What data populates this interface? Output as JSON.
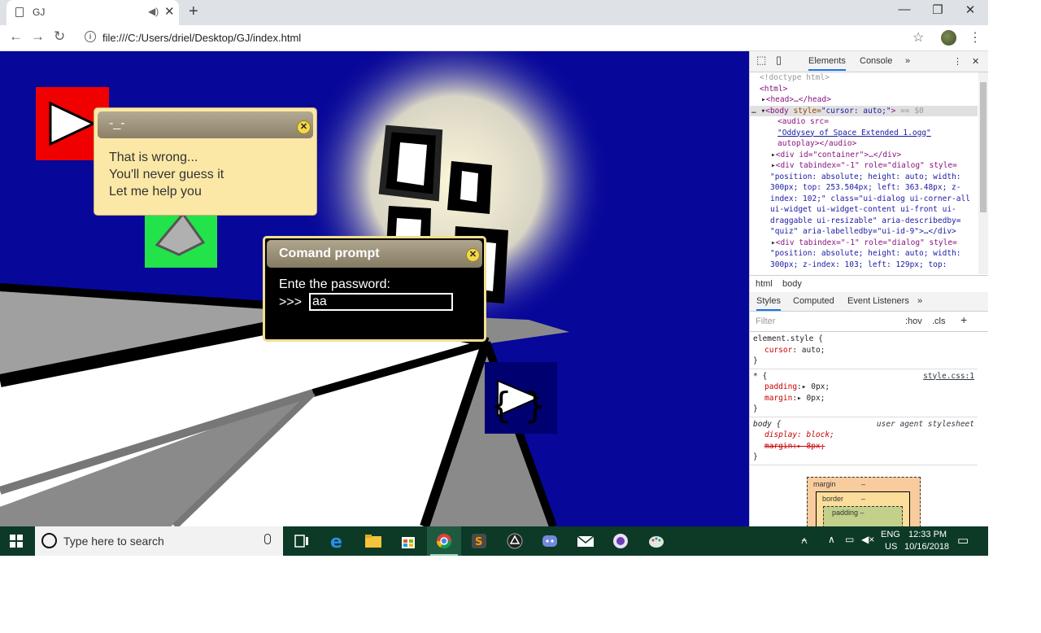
{
  "browser": {
    "tab_title": "GJ",
    "tab_audio_icon": "speaker-icon",
    "url": "file:///C:/Users/driel/Desktop/GJ/index.html",
    "icons": {
      "back": "arrow-left-icon",
      "forward": "arrow-right-icon",
      "reload": "reload-icon",
      "bookmark": "star-icon",
      "menu": "kebab-icon"
    }
  },
  "game": {
    "wrong_dialog": {
      "title": "-_-",
      "lines": [
        "That is wrong...",
        "You'll never guess it",
        "Let me help you"
      ]
    },
    "prompt_dialog": {
      "title": "Comand prompt",
      "instruction": "Ente the password:",
      "cursor": ">>>",
      "input_value": "aa"
    }
  },
  "devtools": {
    "tabs": [
      "Elements",
      "Console"
    ],
    "active_tab": "Elements",
    "dom_lines": {
      "doctype": "<!doctype html>",
      "html": "<html>",
      "head": "<head>…</head>",
      "body_tag": "<body",
      "body_attr": " style=",
      "body_val": "\"cursor: auto;\"",
      "body_end": ">",
      "body_eq": " == $0",
      "audio_tag": "<audio src=",
      "audio_link": "\"Oddysey of Space Extended 1.ogg\"",
      "audio_autoplay": "autoplay></audio>",
      "container_div": "<div id=\"container\">…</div>",
      "div1_l1": "<div tabindex=\"-1\" role=\"dialog\" style=",
      "div1_l2": "\"position: absolute; height: auto; width:",
      "div1_l3": "300px; top: 253.504px; left: 363.48px; z-",
      "div1_l4": "index: 102;\" class=\"ui-dialog ui-corner-all",
      "div1_l5": "ui-widget ui-widget-content ui-front ui-",
      "div1_l6": "draggable ui-resizable\" aria-describedby=",
      "div1_l7": "\"quiz\" aria-labelledby=\"ui-id-9\">…</div>",
      "div2_l1": "<div tabindex=\"-1\" role=\"dialog\" style=",
      "div2_l2": "\"position: absolute; height: auto; width:",
      "div2_l3": "300px; z-index: 103; left: 129px; top:"
    },
    "breadcrumbs": [
      "html",
      "body"
    ],
    "styles_tabs": [
      "Styles",
      "Computed",
      "Event Listeners"
    ],
    "filter_placeholder": "Filter",
    "filter_hov": ":hov",
    "filter_cls": ".cls",
    "rules": {
      "element_selector": "element.style {",
      "element_prop": "cursor",
      "element_val": "auto;",
      "star_selector": "* {",
      "star_source": "style.css:1",
      "star_padding": "padding",
      "star_padding_val": "0px;",
      "star_margin": "margin",
      "star_margin_val": "0px;",
      "body_selector": "body {",
      "body_source": "user agent stylesheet",
      "body_display": "display: block;",
      "body_margin": "margin:▸ 8px;",
      "close_brace": "}"
    },
    "box_model": {
      "margin": "margin",
      "margin_val": "–",
      "border": "border",
      "border_val": "–",
      "padding": "padding –"
    }
  },
  "taskbar": {
    "search_placeholder": "Type here to search",
    "lang_1": "ENG",
    "lang_2": "US",
    "time": "12:33 PM",
    "date": "10/16/2018"
  },
  "colors": {
    "game_bg": "#07079a",
    "taskbar_bg": "#0c3a27",
    "dialog_cream": "#fbe8a6",
    "devtools_accent": "#1a73e8"
  }
}
